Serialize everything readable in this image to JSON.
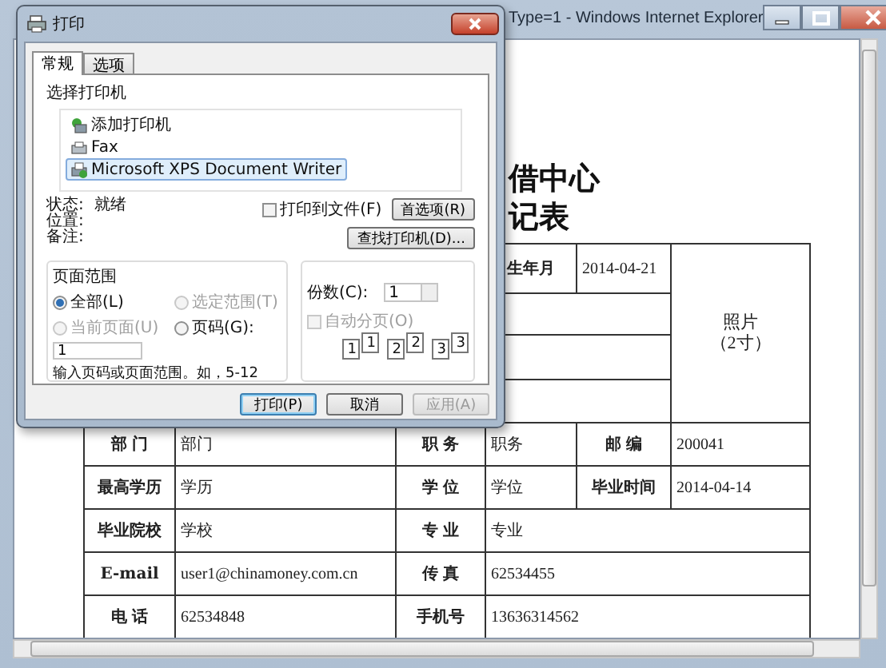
{
  "browser": {
    "title": "Type=1 - Windows Internet Explorer"
  },
  "document": {
    "heading_lines": [
      "借中心",
      "记表"
    ],
    "upper_row": {
      "label": "生年月",
      "value": "2014-04-21"
    },
    "photo_lines": [
      "照片",
      "（2寸）"
    ],
    "rows": [
      [
        {
          "text": "部 门",
          "kind": "label"
        },
        {
          "text": "部门",
          "kind": "value"
        },
        {
          "text": "职 务",
          "kind": "label"
        },
        {
          "text": "职务",
          "kind": "value"
        },
        {
          "text": "邮 编",
          "kind": "label"
        },
        {
          "text": "200041",
          "kind": "value"
        }
      ],
      [
        {
          "text": "最高学历",
          "kind": "label"
        },
        {
          "text": "学历",
          "kind": "value"
        },
        {
          "text": "学 位",
          "kind": "label"
        },
        {
          "text": "学位",
          "kind": "value"
        },
        {
          "text": "毕业时间",
          "kind": "label"
        },
        {
          "text": "2014-04-14",
          "kind": "value"
        }
      ],
      [
        {
          "text": "毕业院校",
          "kind": "label"
        },
        {
          "text": "学校",
          "kind": "value"
        },
        {
          "text": "专 业",
          "kind": "label"
        },
        {
          "text": "专业",
          "kind": "value",
          "colspan": 3
        }
      ],
      [
        {
          "text": "E-mail",
          "kind": "label"
        },
        {
          "text": "user1@chinamoney.com.cn",
          "kind": "value"
        },
        {
          "text": "传 真",
          "kind": "label"
        },
        {
          "text": "62534455",
          "kind": "value",
          "colspan": 3
        }
      ],
      [
        {
          "text": "电 话",
          "kind": "label"
        },
        {
          "text": "62534848",
          "kind": "value"
        },
        {
          "text": "手机号",
          "kind": "label"
        },
        {
          "text": "13636314562",
          "kind": "value",
          "colspan": 3
        }
      ]
    ]
  },
  "print_dialog": {
    "title": "打印",
    "tabs": [
      {
        "label": "常规",
        "selected": true
      },
      {
        "label": "选项",
        "selected": false
      }
    ],
    "printer_group_label": "选择打印机",
    "printers": [
      {
        "name": "添加打印机",
        "kind": "add",
        "selected": false
      },
      {
        "name": "Fax",
        "kind": "fax",
        "selected": false
      },
      {
        "name": "Microsoft XPS Document Writer",
        "kind": "printer",
        "selected": true
      }
    ],
    "status": [
      {
        "label": "状态:",
        "value": "就绪"
      },
      {
        "label": "位置:"
      },
      {
        "label": "备注:"
      }
    ],
    "print_to_file": {
      "label": "打印到文件(F)",
      "checked": false
    },
    "preferences_button": "首选项(R)",
    "find_printer_button": "查找打印机(D)...",
    "page_range": {
      "label": "页面范围",
      "options": [
        {
          "label": "全部(L)",
          "selected": true,
          "disabled": false
        },
        {
          "label": "选定范围(T)",
          "selected": false,
          "disabled": true
        },
        {
          "label": "当前页面(U)",
          "selected": false,
          "disabled": true
        },
        {
          "label": "页码(G):",
          "selected": false,
          "disabled": false
        }
      ],
      "pages_value": "1",
      "hint": "输入页码或页面范围。如，5-12"
    },
    "copies": {
      "label": "份数(C):",
      "value": "1",
      "collate": {
        "label": "自动分页(O)",
        "checked": false,
        "disabled": true
      },
      "collate_pages": [
        "1",
        "1",
        "2",
        "2",
        "3",
        "3"
      ]
    },
    "buttons": [
      {
        "label": "打印(P)",
        "kind": "default",
        "disabled": false
      },
      {
        "label": "取消",
        "kind": "normal",
        "disabled": false
      },
      {
        "label": "应用(A)",
        "kind": "normal",
        "disabled": true
      }
    ]
  }
}
